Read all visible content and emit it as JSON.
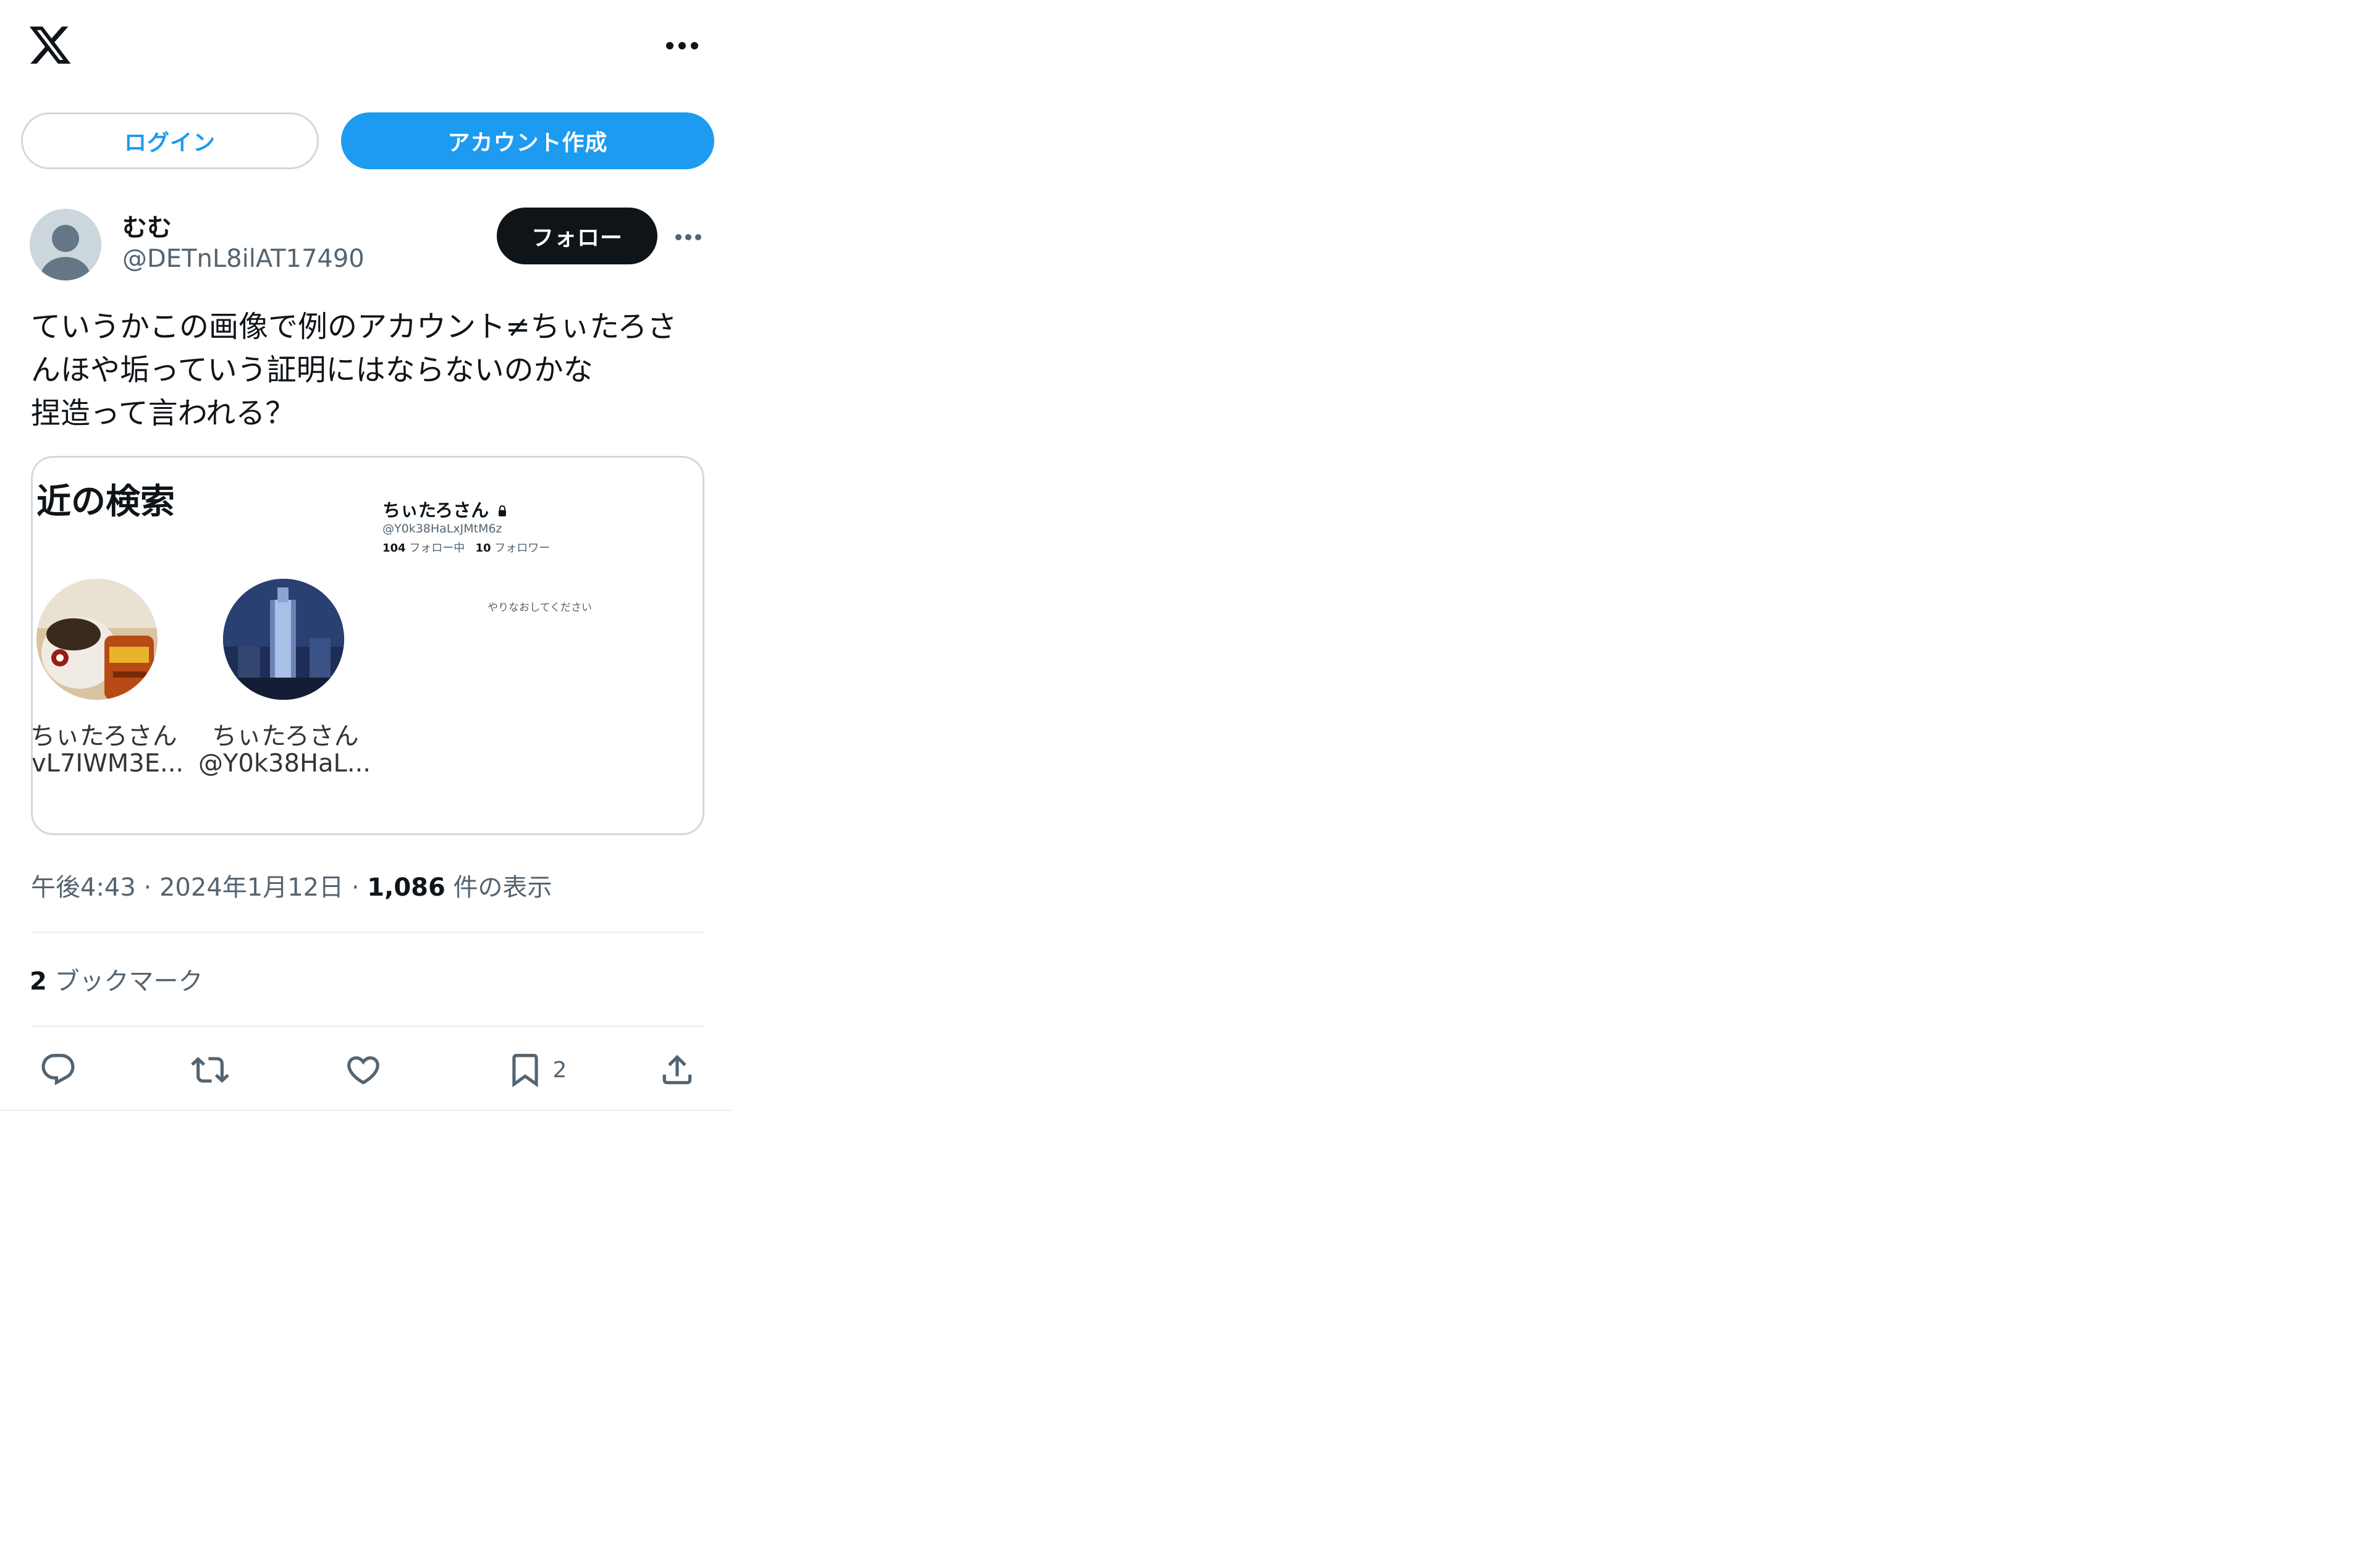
{
  "header": {
    "logo_icon": "x-logo-icon",
    "more_icon": "more-horizontal-icon"
  },
  "auth": {
    "login_label": "ログイン",
    "signup_label": "アカウント作成"
  },
  "tweet": {
    "author": {
      "name": "むむ",
      "handle": "@DETnL8ilAT17490",
      "follow_label": "フォロー"
    },
    "text_lines": [
      "ていうかこの画像で例のアカウント≠ちぃたろさ",
      "んほや垢っていう証明にはならないのかな",
      "捏造って言われる？"
    ],
    "embedded_image": {
      "recent_title": "近の検索",
      "results": [
        {
          "name": "ちぃたろさん",
          "handle": "vL7IWM3E..."
        },
        {
          "name": "ちぃたろさん",
          "handle": "@Y0k38HaL..."
        }
      ],
      "profile": {
        "name": "ちぃたろさん",
        "handle": "@Y0k38HaLxJMtM6z",
        "following_count": "104",
        "following_label": "フォロー中",
        "followers_count": "10",
        "followers_label": "フォロワー",
        "retry_text": "やりなおしてください"
      }
    },
    "meta": {
      "time": "午後4:43",
      "separator": "·",
      "date": "2024年1月12日",
      "views_count": "1,086",
      "views_label": "件の表示"
    },
    "bookmarks": {
      "count": "2",
      "label": "ブックマーク"
    },
    "actions": [
      {
        "name": "reply",
        "icon": "reply-icon",
        "count": ""
      },
      {
        "name": "retweet",
        "icon": "retweet-icon",
        "count": ""
      },
      {
        "name": "like",
        "icon": "heart-icon",
        "count": ""
      },
      {
        "name": "bookmark",
        "icon": "bookmark-icon",
        "count": "2"
      },
      {
        "name": "share",
        "icon": "share-icon",
        "count": ""
      }
    ]
  },
  "colors": {
    "accent": "#1d9bf0",
    "text": "#0f1419",
    "secondary_text": "#536471",
    "border": "#cfd9de"
  }
}
